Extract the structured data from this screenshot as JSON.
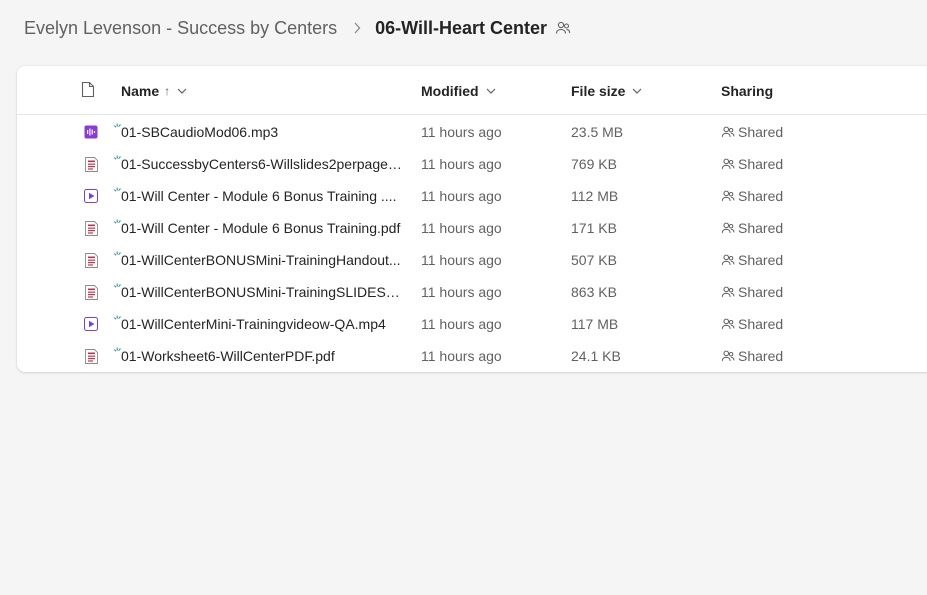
{
  "breadcrumb": {
    "parent": "Evelyn Levenson - Success by Centers",
    "separator": "›",
    "current": "06-Will-Heart Center"
  },
  "columns": {
    "name": "Name",
    "name_sort": "↑",
    "modified": "Modified",
    "file_size": "File size",
    "sharing": "Sharing"
  },
  "icon_colors": {
    "audio": "#8a3ad8",
    "video": "#7b3fe4",
    "pdf": "#c4314b"
  },
  "files": [
    {
      "icon": "audio-file-icon",
      "type": "audio",
      "name": "01-SBCaudioMod06.mp3",
      "modified": "11 hours ago",
      "size": "23.5 MB",
      "sharing": "Shared"
    },
    {
      "icon": "pdf-file-icon",
      "type": "pdf",
      "name": "01-SuccessbyCenters6-Willslides2perpageP...",
      "modified": "11 hours ago",
      "size": "769 KB",
      "sharing": "Shared"
    },
    {
      "icon": "video-file-icon",
      "type": "video",
      "name": "01-Will Center - Module 6 Bonus Training ....",
      "modified": "11 hours ago",
      "size": "112 MB",
      "sharing": "Shared"
    },
    {
      "icon": "pdf-file-icon",
      "type": "pdf",
      "name": "01-Will Center - Module 6 Bonus Training.pdf",
      "modified": "11 hours ago",
      "size": "171 KB",
      "sharing": "Shared"
    },
    {
      "icon": "pdf-file-icon",
      "type": "pdf",
      "name": "01-WillCenterBONUSMini-TrainingHandout...",
      "modified": "11 hours ago",
      "size": "507 KB",
      "sharing": "Shared"
    },
    {
      "icon": "pdf-file-icon",
      "type": "pdf",
      "name": "01-WillCenterBONUSMini-TrainingSLIDES2-...",
      "modified": "11 hours ago",
      "size": "863 KB",
      "sharing": "Shared"
    },
    {
      "icon": "video-file-icon",
      "type": "video",
      "name": "01-WillCenterMini-Trainingvideow-QA.mp4",
      "modified": "11 hours ago",
      "size": "117 MB",
      "sharing": "Shared"
    },
    {
      "icon": "pdf-file-icon",
      "type": "pdf",
      "name": "01-Worksheet6-WillCenterPDF.pdf",
      "modified": "11 hours ago",
      "size": "24.1 KB",
      "sharing": "Shared"
    }
  ]
}
